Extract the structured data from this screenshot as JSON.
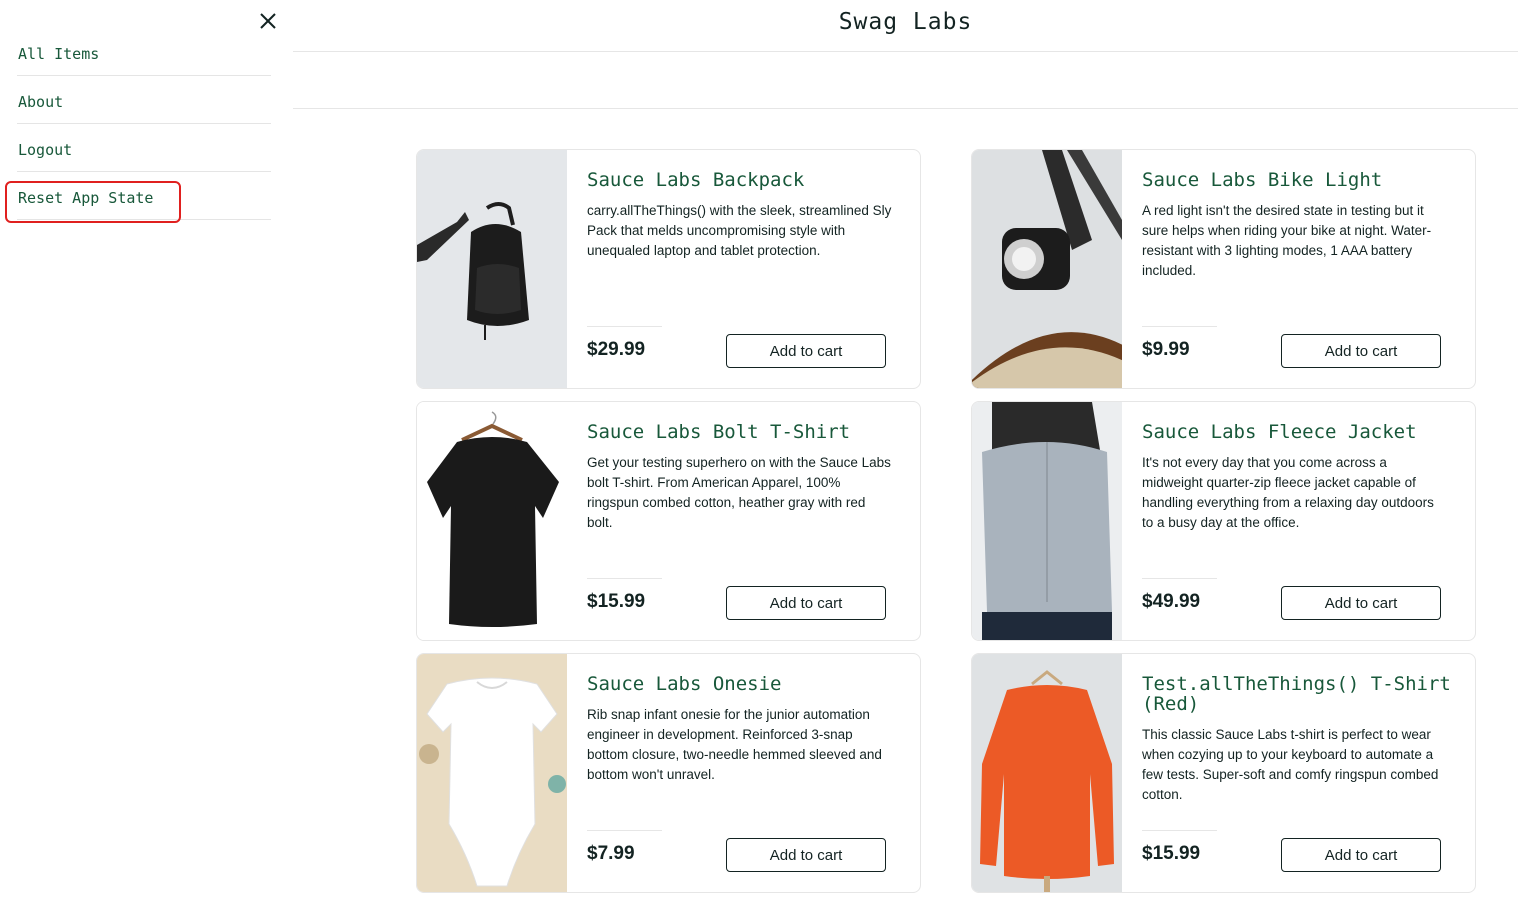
{
  "app_title": "Swag Labs",
  "sidebar": {
    "close_icon": "close-icon",
    "items": [
      {
        "label": "All Items"
      },
      {
        "label": "About"
      },
      {
        "label": "Logout"
      },
      {
        "label": "Reset App State"
      }
    ],
    "highlight_color": "#e0201f"
  },
  "colors": {
    "link_green": "#18583a",
    "text_dark": "#132322"
  },
  "products": [
    {
      "name": "Sauce Labs Backpack",
      "description": "carry.allTheThings() with the sleek, streamlined Sly Pack that melds uncompromising style with unequaled laptop and tablet protection.",
      "price": "$29.99",
      "button": "Add to cart"
    },
    {
      "name": "Sauce Labs Bike Light",
      "description": "A red light isn't the desired state in testing but it sure helps when riding your bike at night. Water-resistant with 3 lighting modes, 1 AAA battery included.",
      "price": "$9.99",
      "button": "Add to cart"
    },
    {
      "name": "Sauce Labs Bolt T-Shirt",
      "description": "Get your testing superhero on with the Sauce Labs bolt T-shirt. From American Apparel, 100% ringspun combed cotton, heather gray with red bolt.",
      "price": "$15.99",
      "button": "Add to cart"
    },
    {
      "name": "Sauce Labs Fleece Jacket",
      "description": "It's not every day that you come across a midweight quarter-zip fleece jacket capable of handling everything from a relaxing day outdoors to a busy day at the office.",
      "price": "$49.99",
      "button": "Add to cart"
    },
    {
      "name": "Sauce Labs Onesie",
      "description": "Rib snap infant onesie for the junior automation engineer in development. Reinforced 3-snap bottom closure, two-needle hemmed sleeved and bottom won't unravel.",
      "price": "$7.99",
      "button": "Add to cart"
    },
    {
      "name": "Test.allTheThings() T-Shirt (Red)",
      "description": "This classic Sauce Labs t-shirt is perfect to wear when cozying up to your keyboard to automate a few tests. Super-soft and comfy ringspun combed cotton.",
      "price": "$15.99",
      "button": "Add to cart"
    }
  ]
}
